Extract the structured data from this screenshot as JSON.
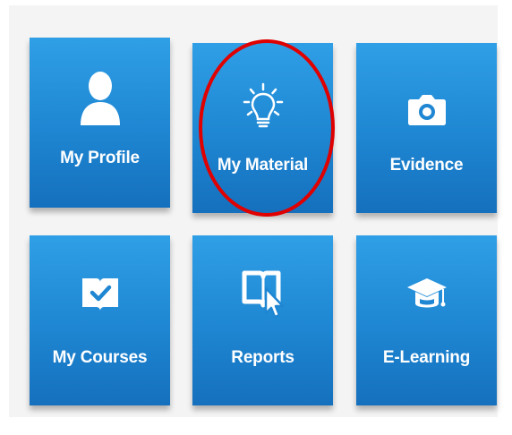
{
  "tiles": [
    {
      "id": "my-profile",
      "label": "My Profile",
      "icon": "person-icon"
    },
    {
      "id": "my-material",
      "label": "My Material",
      "icon": "lightbulb-icon"
    },
    {
      "id": "evidence",
      "label": "Evidence",
      "icon": "camera-icon"
    },
    {
      "id": "my-courses",
      "label": "My Courses",
      "icon": "checked-book-icon"
    },
    {
      "id": "reports",
      "label": "Reports",
      "icon": "book-cursor-icon"
    },
    {
      "id": "e-learning",
      "label": "E-Learning",
      "icon": "graduation-cap-icon"
    }
  ],
  "colors": {
    "tile_top": "#2f9fe6",
    "tile_bottom": "#1570bd",
    "highlight": "#e00000",
    "label": "#ffffff"
  }
}
